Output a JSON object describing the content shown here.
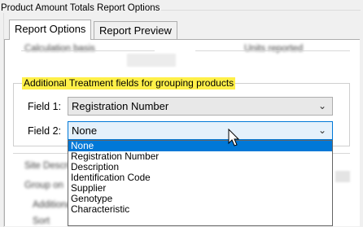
{
  "window": {
    "group_title": "Product Amount Totals Report Options"
  },
  "tabs": [
    {
      "label": "Report Options",
      "active": true
    },
    {
      "label": "Report Preview",
      "active": false
    }
  ],
  "obscured": {
    "calculation_basis": "Calculation basis",
    "units_reported": "Units reported",
    "row1": "Site Description",
    "row2": "Group on",
    "row3": "Additional",
    "row4": "Sort"
  },
  "grouping": {
    "title": "Additional Treatment fields for grouping products",
    "field1": {
      "label": "Field 1:",
      "value": "Registration Number"
    },
    "field2": {
      "label": "Field 2:",
      "value": "None"
    }
  },
  "dropdown": {
    "options": [
      "None",
      "Registration Number",
      "Description",
      "Identification Code",
      "Supplier",
      "Genotype",
      "Characteristic"
    ],
    "selected_index": 0
  },
  "icons": {
    "arrow": "chevron-down-icon",
    "cursor": "mouse-pointer-icon"
  },
  "colors": {
    "highlight": "#fff048",
    "selection": "#0078d7",
    "focus_bg": "#e5f1fb"
  }
}
